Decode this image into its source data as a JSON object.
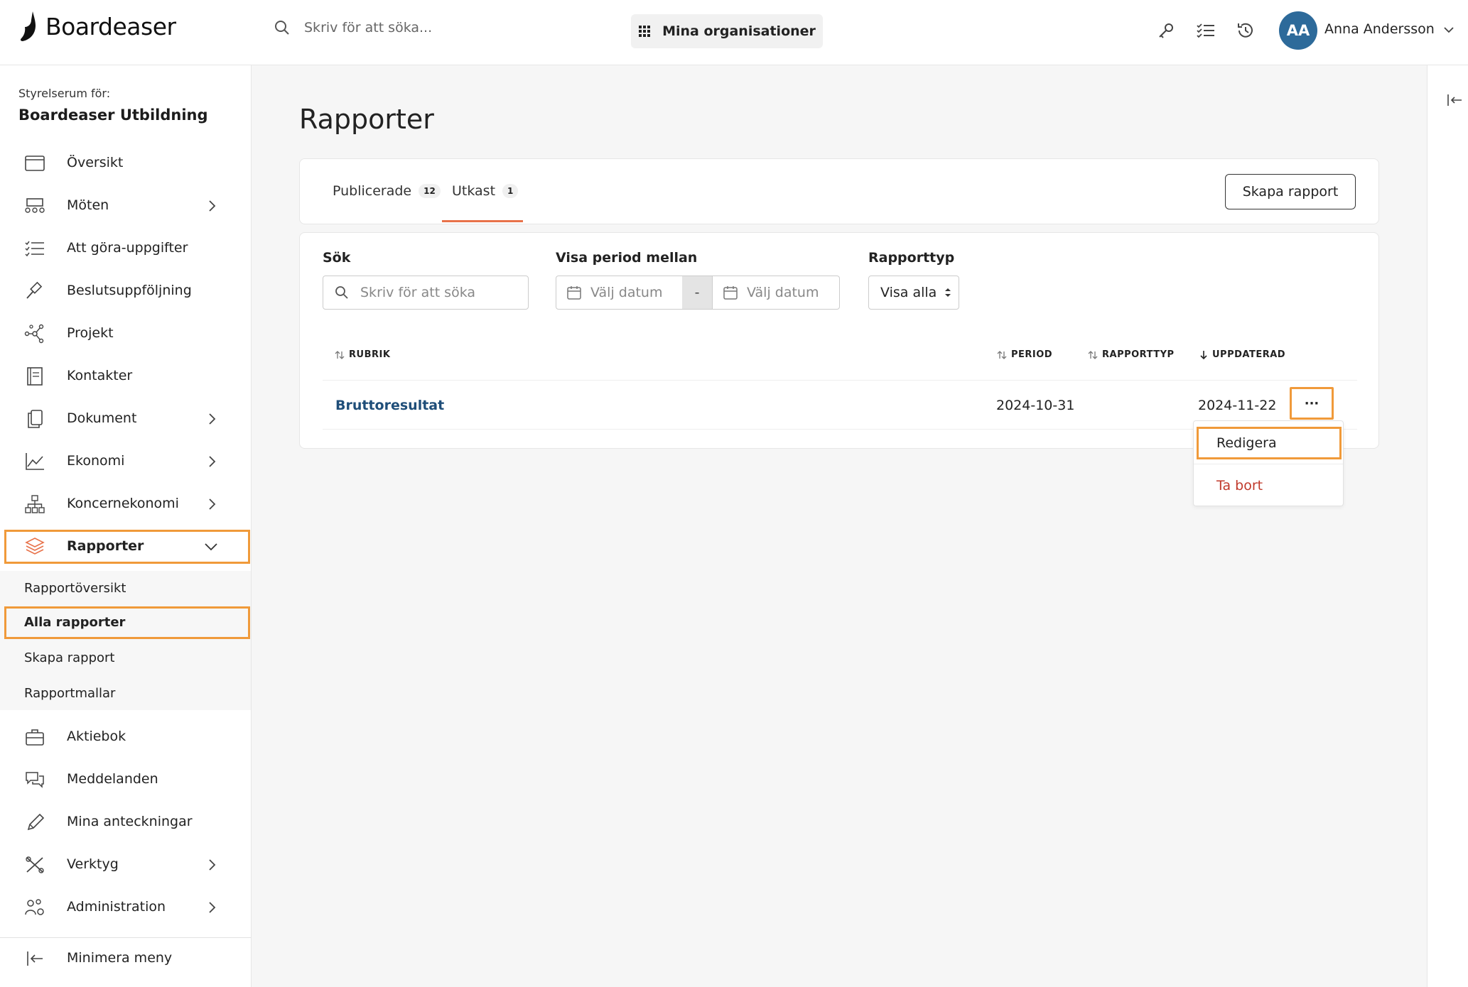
{
  "header": {
    "brand": "Boardeaser",
    "search_placeholder": "Skriv för att söka...",
    "org_button": "Mina organisationer",
    "user_initials": "AA",
    "user_name": "Anna Andersson"
  },
  "sidebar": {
    "caption": "Styrelserum för:",
    "org_name": "Boardeaser Utbildning",
    "items": [
      {
        "label": "Översikt"
      },
      {
        "label": "Möten"
      },
      {
        "label": "Att göra-uppgifter"
      },
      {
        "label": "Beslutsuppföljning"
      },
      {
        "label": "Projekt"
      },
      {
        "label": "Kontakter"
      },
      {
        "label": "Dokument"
      },
      {
        "label": "Ekonomi"
      },
      {
        "label": "Koncernekonomi"
      },
      {
        "label": "Rapporter"
      },
      {
        "label": "Aktiebok"
      },
      {
        "label": "Meddelanden"
      },
      {
        "label": "Mina anteckningar"
      },
      {
        "label": "Verktyg"
      },
      {
        "label": "Administration"
      }
    ],
    "sub_items": [
      {
        "label": "Rapportöversikt"
      },
      {
        "label": "Alla rapporter"
      },
      {
        "label": "Skapa rapport"
      },
      {
        "label": "Rapportmallar"
      }
    ],
    "minimize": "Minimera meny"
  },
  "main": {
    "title": "Rapporter",
    "tabs": [
      {
        "label": "Publicerade",
        "count": "12"
      },
      {
        "label": "Utkast",
        "count": "1"
      }
    ],
    "create_button": "Skapa rapport",
    "filters": {
      "search_label": "Sök",
      "search_placeholder": "Skriv för att söka",
      "period_label": "Visa period mellan",
      "date_placeholder": "Välj datum",
      "separator": "-",
      "type_label": "Rapporttyp",
      "type_value": "Visa alla"
    },
    "table": {
      "headers": [
        "RUBRIK",
        "PERIOD",
        "RAPPORTTYP",
        "UPPDATERAD"
      ],
      "rows": [
        {
          "title": "Bruttoresultat",
          "period": "2024-10-31",
          "type": "",
          "updated": "2024-11-22"
        }
      ],
      "more_label": "···"
    },
    "row_menu": {
      "edit": "Redigera",
      "delete": "Ta bort"
    }
  },
  "colors": {
    "accent": "#e8724a",
    "highlight": "#f09a3a",
    "avatar": "#2d6a9a",
    "link": "#1f4e79",
    "danger": "#c0392b"
  }
}
